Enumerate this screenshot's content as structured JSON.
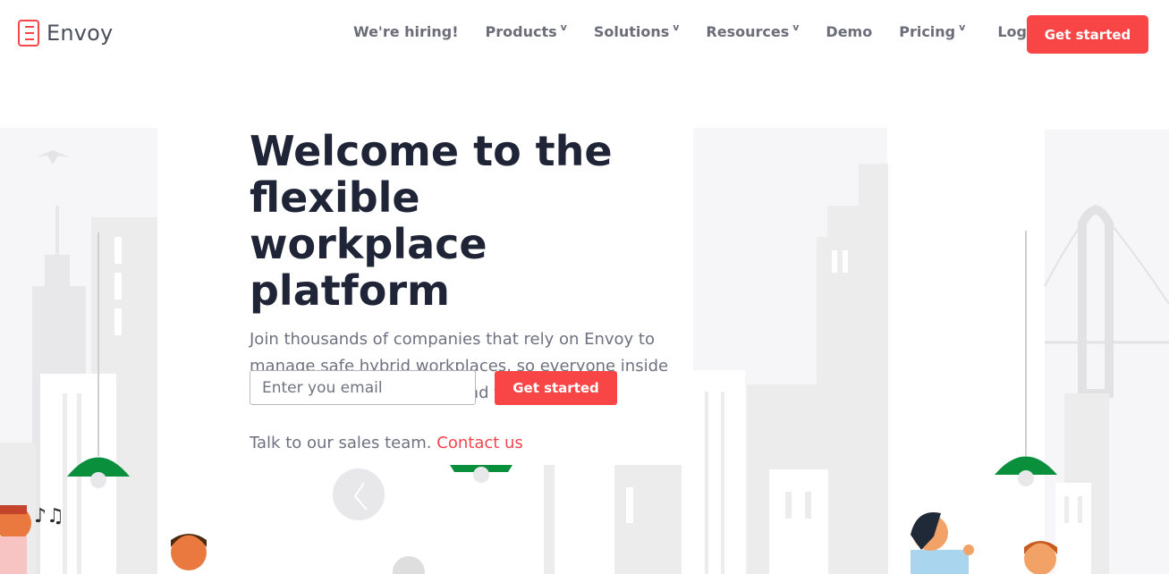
{
  "brand": {
    "name": "Envoy"
  },
  "nav": {
    "links": [
      {
        "label": "We're hiring!",
        "has_dropdown": false
      },
      {
        "label": "Products",
        "has_dropdown": true
      },
      {
        "label": "Solutions",
        "has_dropdown": true
      },
      {
        "label": "Resources",
        "has_dropdown": true
      },
      {
        "label": "Demo",
        "has_dropdown": false
      },
      {
        "label": "Pricing",
        "has_dropdown": true
      }
    ],
    "dropdown_glyph": "v",
    "login": "Log in",
    "cta": "Get started"
  },
  "hero": {
    "headline": "Welcome to the flexible workplace platform",
    "subtext": "Join thousands of companies that rely on Envoy to manage safe hybrid workplaces, so everyone inside can connect, collaborate, and thrive.",
    "email_placeholder": "Enter you email",
    "cta": "Get started",
    "sales_text": "Talk to our sales team.",
    "sales_link": "Contact us"
  },
  "colors": {
    "accent": "#f84646",
    "heading": "#1f2537",
    "body_text": "#6e7280",
    "nav_text": "#6b6e78",
    "building_light": "#f6f6f8",
    "building_mid": "#ebebeb",
    "lamp_green": "#0a8f3c"
  },
  "icons": [
    "envoy-logo-icon",
    "chevron-down-icon",
    "clock-icon",
    "music-notes-icon",
    "pendant-lamp-icon"
  ]
}
